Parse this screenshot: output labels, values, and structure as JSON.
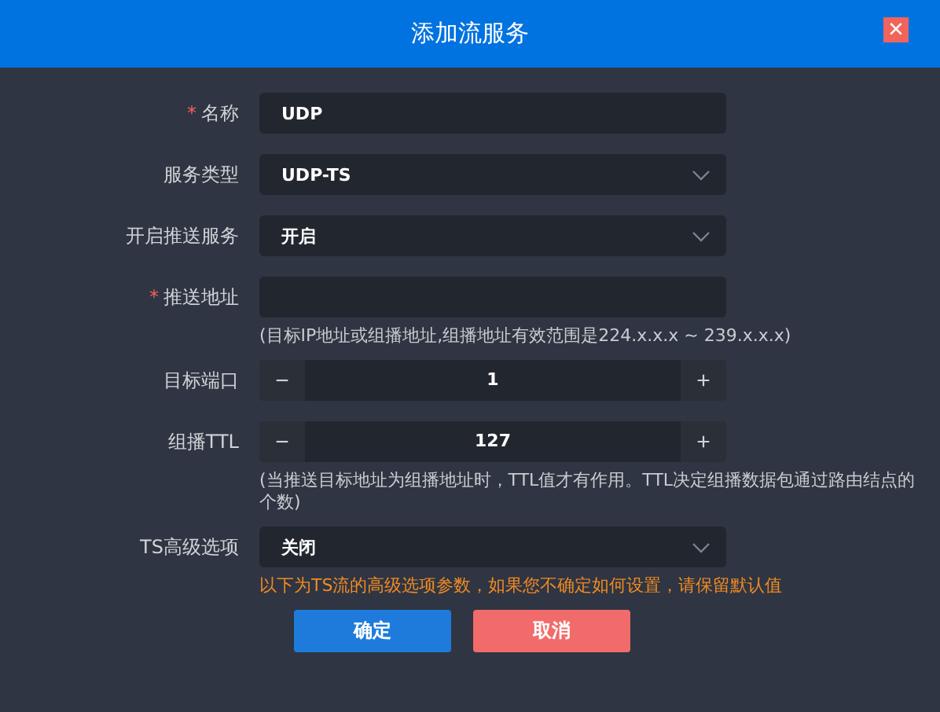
{
  "window": {
    "title": "添加流服务",
    "close": "×"
  },
  "form": [
    {
      "kind": "text",
      "label": "名称",
      "required": true,
      "value": "UDP"
    },
    {
      "kind": "select",
      "label": "服务类型",
      "required": false,
      "value": "UDP-TS"
    },
    {
      "kind": "select",
      "label": "开启推送服务",
      "required": false,
      "value": "开启"
    },
    {
      "kind": "text",
      "label": "推送地址",
      "required": true
    },
    {
      "kind": "hint",
      "text": "(目标IP地址或组播地址,组播地址有效范围是224.x.x.x ~ 239.x.x.x)"
    },
    {
      "kind": "number",
      "label": "目标端口",
      "required": false,
      "value": "1",
      "minus": "−",
      "plus": "+"
    },
    {
      "kind": "number",
      "label": "组播TTL",
      "required": false,
      "value": "127",
      "minus": "−",
      "plus": "+"
    },
    {
      "kind": "hint",
      "text": "(当推送目标地址为组播地址时，TTL值才有作用。TTL决定组播数据包通过路由结点的个数)"
    },
    {
      "kind": "select",
      "label": "TS高级选项",
      "required": false,
      "value": "关闭"
    },
    {
      "kind": "warning",
      "text": "以下为TS流的高级选项参数，如果您不确定如何设置，请保留默认值"
    }
  ],
  "required_mark": "*",
  "buttons": [
    {
      "label": "确定",
      "kind": "primary"
    },
    {
      "label": "取消",
      "kind": "danger"
    }
  ]
}
